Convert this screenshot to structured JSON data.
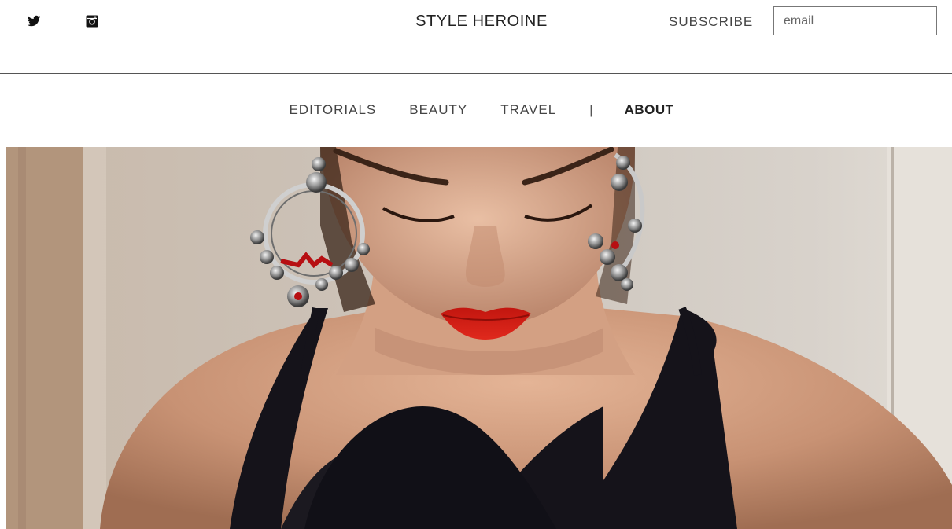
{
  "header": {
    "brand": "STYLE HEROINE",
    "subscribe_label": "SUBSCRIBE",
    "email_placeholder": "email",
    "social": [
      "twitter-icon",
      "instagram-icon"
    ]
  },
  "nav": {
    "items": [
      {
        "label": "EDITORIALS"
      },
      {
        "label": "BEAUTY"
      },
      {
        "label": "TRAVEL"
      }
    ],
    "separator": "|",
    "about": "ABOUT"
  },
  "colors": {
    "background": "#ffffff",
    "text": "#222222",
    "lip": "#d8241c",
    "dress": "#15131a"
  }
}
